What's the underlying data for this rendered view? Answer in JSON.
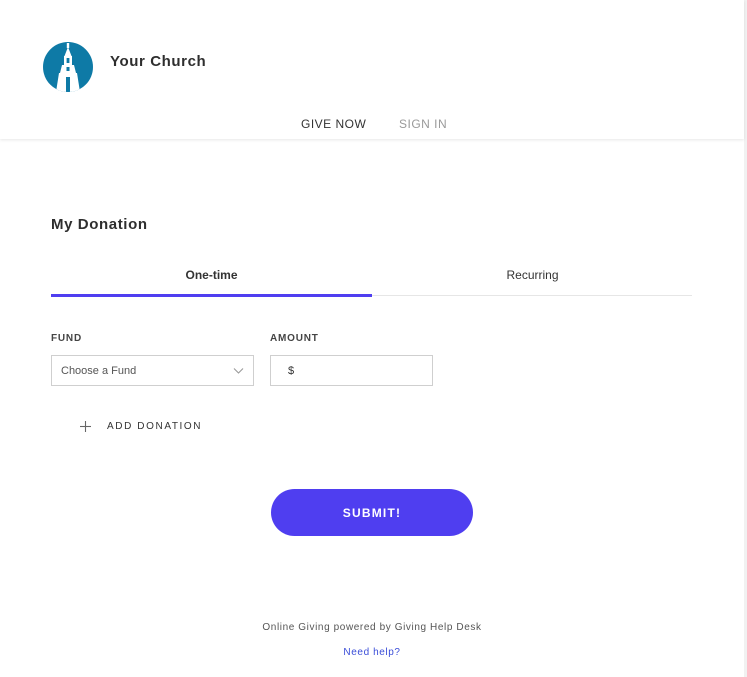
{
  "header": {
    "church_name": "Your Church",
    "nav": [
      {
        "label": "GIVE NOW"
      },
      {
        "label": "SIGN IN"
      }
    ]
  },
  "donation": {
    "title": "My Donation",
    "tabs": [
      {
        "label": "One-time",
        "active": true
      },
      {
        "label": "Recurring",
        "active": false
      }
    ],
    "fund": {
      "label": "FUND",
      "selected": "Choose a Fund"
    },
    "amount": {
      "label": "AMOUNT",
      "currency": "$",
      "value": ""
    },
    "add_label": "ADD DONATION",
    "submit_label": "SUBMIT!"
  },
  "footer": {
    "powered_by": "Online Giving powered by Giving Help Desk",
    "help_link": "Need help?"
  },
  "colors": {
    "accent": "#4f3ef0",
    "logo_bg": "#0e7aa6",
    "link": "#3b4ed8"
  },
  "icons": {
    "logo": "church-steeple-icon",
    "chevron": "chevron-down-icon",
    "add": "plus-icon"
  }
}
